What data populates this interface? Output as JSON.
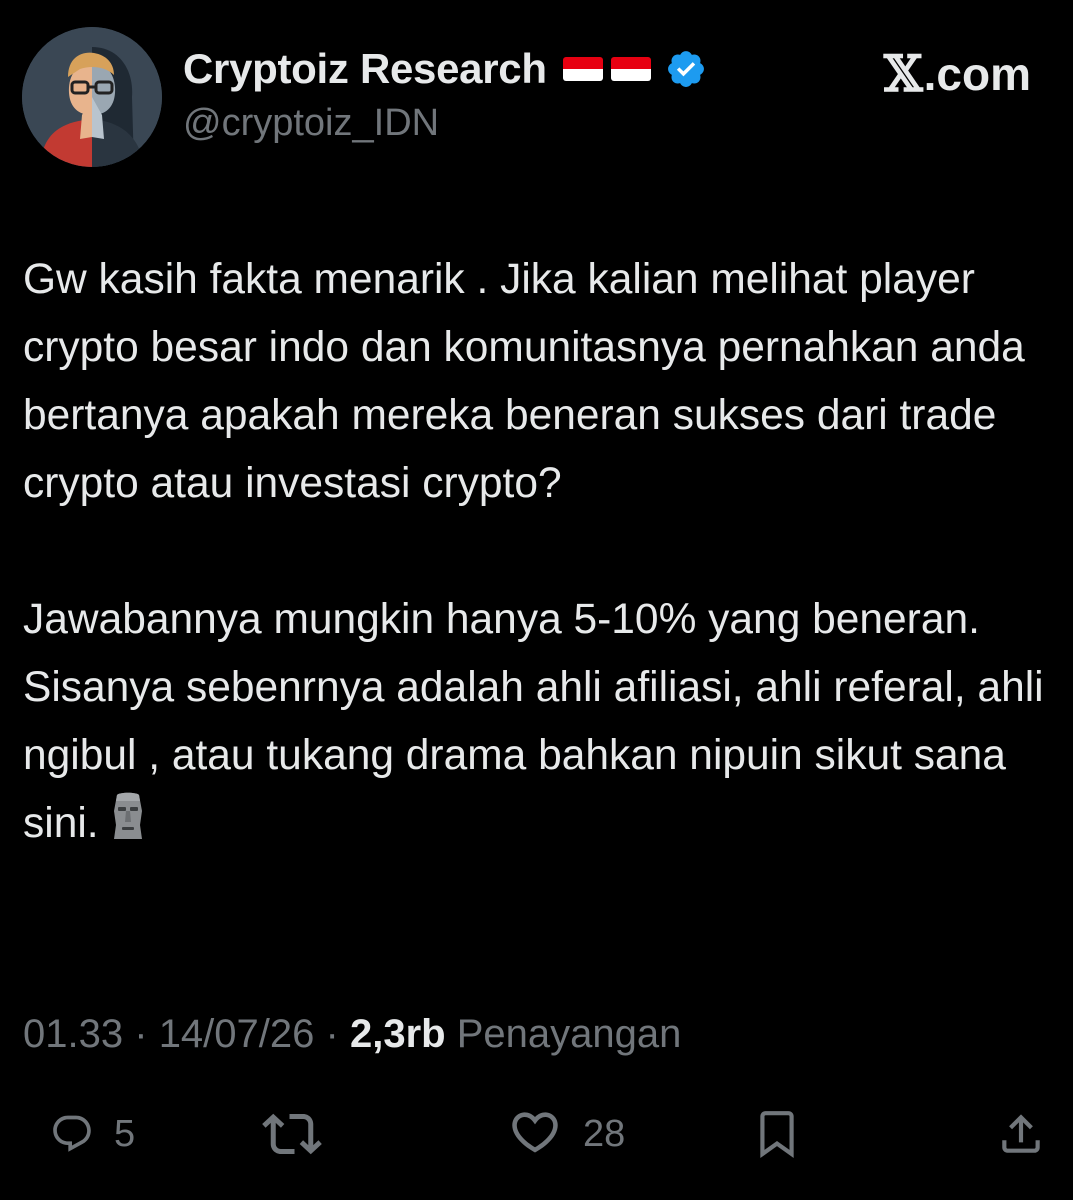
{
  "author": {
    "display_name": "Cryptoiz Research",
    "handle": "@cryptoiz_IDN",
    "flags": [
      "indonesia-flag",
      "indonesia-flag"
    ],
    "verified": true
  },
  "brand": {
    "x_glyph": "𝕏",
    "label": ".com"
  },
  "tweet": {
    "paragraph_1": "Gw kasih fakta menarik . Jika kalian melihat player crypto besar indo dan komunitasnya pernahkan anda bertanya apakah mereka beneran sukses dari trade crypto atau investasi crypto?",
    "paragraph_2": "Jawabannya mungkin hanya 5-10% yang beneran. Sisanya sebenrnya adalah ahli afiliasi, ahli referal, ahli ngibul , atau tukang drama bahkan nipuin sikut sana sini.",
    "emoji": "moai-emoji"
  },
  "meta": {
    "time": "01.33",
    "date": "14/07/26",
    "separator": "·",
    "views_count": "2,3rb",
    "views_label": "Penayangan"
  },
  "actions": {
    "replies": "5",
    "retweets": "",
    "likes": "28",
    "icons": [
      "reply-icon",
      "retweet-icon",
      "like-icon",
      "bookmark-icon",
      "share-icon"
    ]
  },
  "colors": {
    "background": "#000000",
    "text": "#e7e9ea",
    "secondary_text": "#71767b",
    "verified_blue": "#1d9bf0"
  }
}
